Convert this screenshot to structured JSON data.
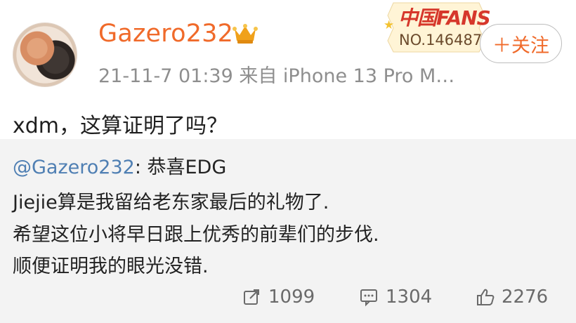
{
  "header": {
    "username": "Gazero232",
    "timestamp": "21-11-7 01:39  来自 iPhone 13 Pro M…",
    "fan_badge": {
      "title": "中国FANS",
      "number": "NO.146487"
    },
    "follow_label": "＋关注"
  },
  "post": {
    "text": "xdm，这算证明了吗？"
  },
  "repost": {
    "mention": "@Gazero232",
    "headline": ": 恭喜EDG",
    "lines": [
      "Jiejie算是我留给老东家最后的礼物了.",
      "希望这位小将早日跟上优秀的前辈们的步伐.",
      "顺便证明我的眼光没错."
    ]
  },
  "stats": {
    "reposts": "1099",
    "comments": "1304",
    "likes": "2276"
  },
  "colors": {
    "accent": "#f06a2a",
    "mention": "#4f7fb3",
    "secondary_text": "#8e8e8e"
  }
}
